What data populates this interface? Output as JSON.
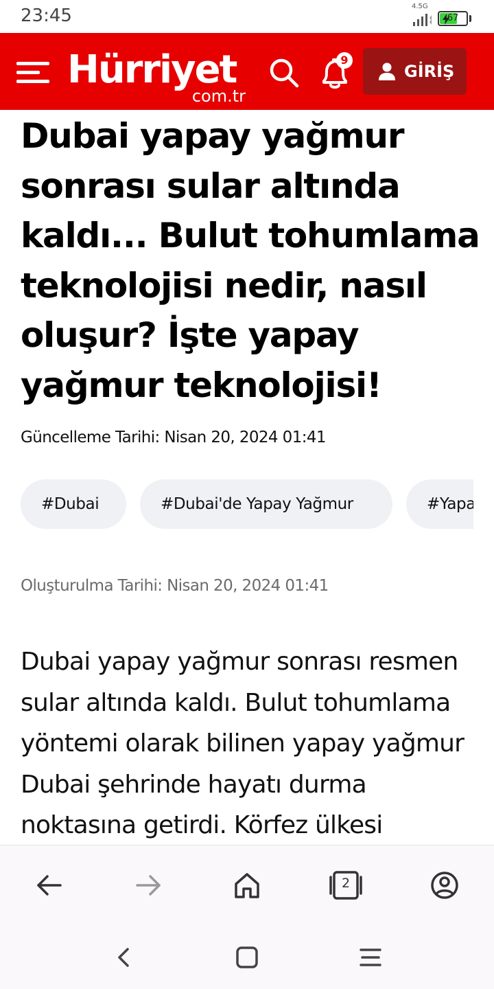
{
  "status_bar": {
    "time": "23:45",
    "network": "4.5G",
    "battery": "67",
    "battery_level": 0.67
  },
  "header": {
    "logo_main": "Hürriyet",
    "logo_sub": "com.tr",
    "notification_count": "9",
    "login_label": "GİRİŞ",
    "brand_color": "#e60000"
  },
  "article": {
    "headline": "Dubai yapay yağmur sonrası sular altında kaldı... Bulut tohumlama teknolojisi nedir, nasıl oluşur? İşte yapay yağmur teknolojisi!",
    "updated": "Güncelleme Tarihi: Nisan 20, 2024 01:41",
    "tags": [
      "#Dubai",
      "#Dubai'de Yapay Yağmur",
      "#Yapay"
    ],
    "created": "Oluşturulma Tarihi: Nisan 20, 2024 01:41",
    "body": "Dubai yapay yağmur sonrası resmen sular altında kaldı. Bulut tohumlama yöntemi olarak bilinen yapay yağmur Dubai şehrinde hayatı durma noktasına getirdi. Körfez ülkesi"
  },
  "browser_nav": {
    "tab_count": "2"
  }
}
